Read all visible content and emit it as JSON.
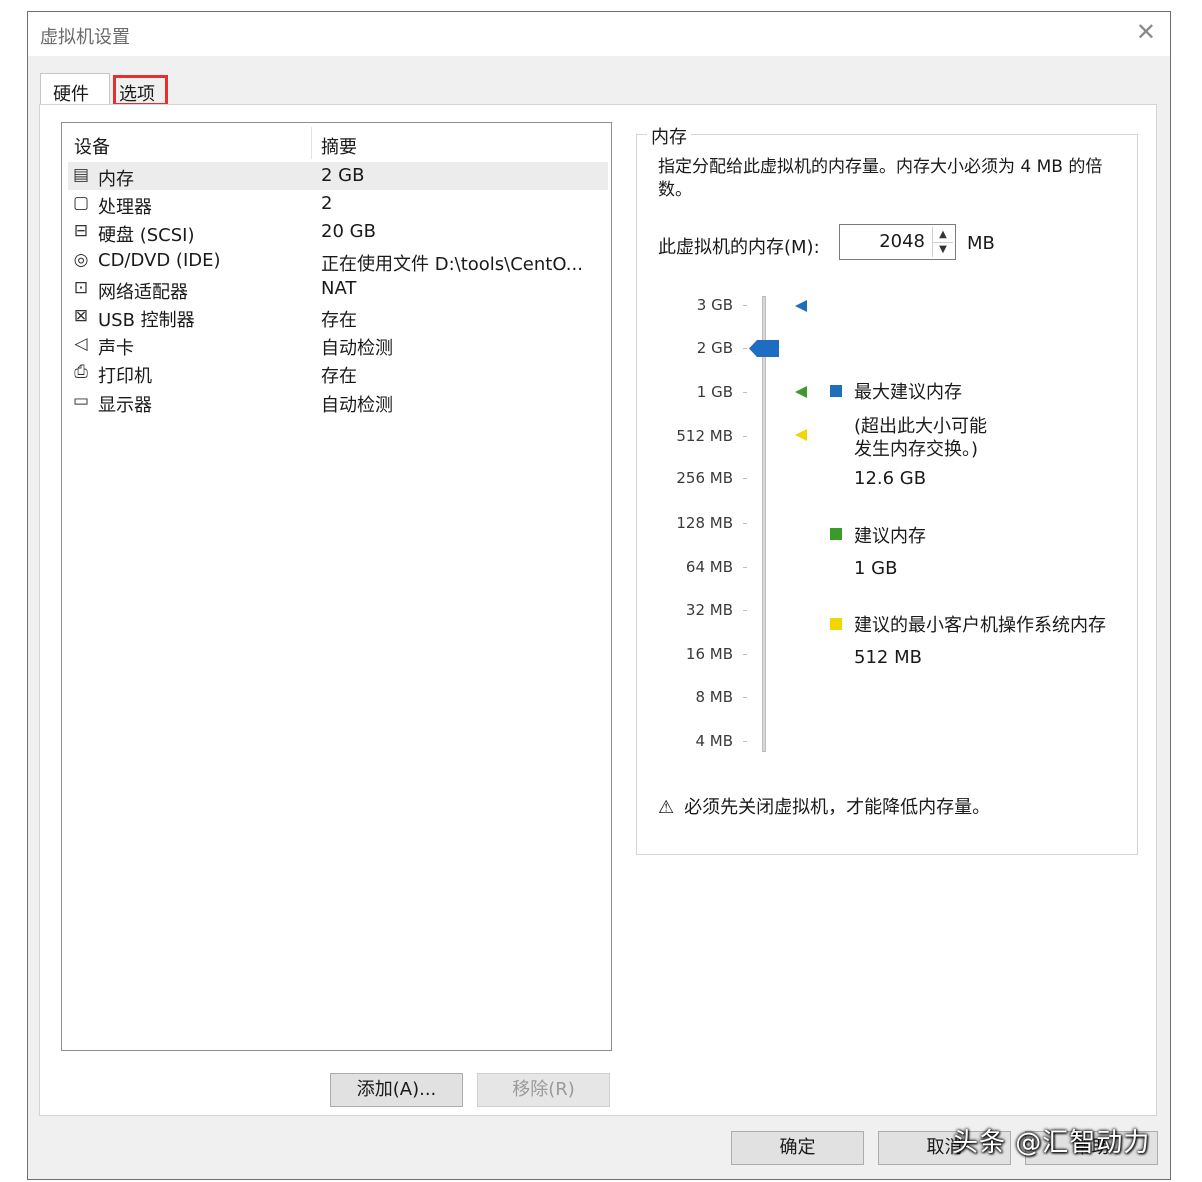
{
  "window": {
    "title": "虚拟机设置",
    "close_glyph": "✕"
  },
  "tabs": [
    {
      "label": "硬件"
    },
    {
      "label": "选项"
    }
  ],
  "device_list": {
    "headers": {
      "device": "设备",
      "summary": "摘要"
    },
    "rows": [
      {
        "icon": "memory-icon",
        "glyph": "▤",
        "name": "内存",
        "summary": "2 GB"
      },
      {
        "icon": "processor-icon",
        "glyph": "▢",
        "name": "处理器",
        "summary": "2"
      },
      {
        "icon": "harddisk-icon",
        "glyph": "⊟",
        "name": "硬盘 (SCSI)",
        "summary": "20 GB"
      },
      {
        "icon": "cd-dvd-icon",
        "glyph": "◎",
        "name": "CD/DVD (IDE)",
        "summary": "正在使用文件 D:\\tools\\CentO..."
      },
      {
        "icon": "network-adapter-icon",
        "glyph": "⊡",
        "name": "网络适配器",
        "summary": "NAT"
      },
      {
        "icon": "usb-icon",
        "glyph": "⊠",
        "name": "USB 控制器",
        "summary": "存在"
      },
      {
        "icon": "sound-card-icon",
        "glyph": "◁",
        "name": "声卡",
        "summary": "自动检测"
      },
      {
        "icon": "printer-icon",
        "glyph": "⎙",
        "name": "打印机",
        "summary": "存在"
      },
      {
        "icon": "display-icon",
        "glyph": "▭",
        "name": "显示器",
        "summary": "自动检测"
      }
    ]
  },
  "buttons": {
    "add": "添加(A)...",
    "remove": "移除(R)",
    "ok": "确定",
    "cancel": "取消",
    "help": "帮助"
  },
  "memory_panel": {
    "group_title": "内存",
    "description": "指定分配给此虚拟机的内存量。内存大小必须为 4 MB 的倍数。",
    "memory_label": "此虚拟机的内存(M):",
    "memory_value": "2048",
    "unit": "MB",
    "scale": [
      "3 GB",
      "2 GB",
      "1 GB",
      "512 MB",
      "256 MB",
      "128 MB",
      "64 MB",
      "32 MB",
      "16 MB",
      "8 MB",
      "4 MB"
    ],
    "legend": {
      "max_title": "最大建议内存",
      "max_note_1": "(超出此大小可能",
      "max_note_2": "发生内存交换。)",
      "max_value": "12.6 GB",
      "rec_title": "建议内存",
      "rec_value": "1 GB",
      "min_title": "建议的最小客户机操作系统内存",
      "min_value": "512 MB"
    },
    "colors": {
      "max": "#1f6fb8",
      "recommended": "#3a9a2a",
      "minimum": "#f2d600",
      "thumb": "#1b6ec2"
    },
    "warning_icon": "warning-triangle-icon",
    "warning": "必须先关闭虚拟机，才能降低内存量。"
  },
  "watermark": "头条 @汇智动力"
}
